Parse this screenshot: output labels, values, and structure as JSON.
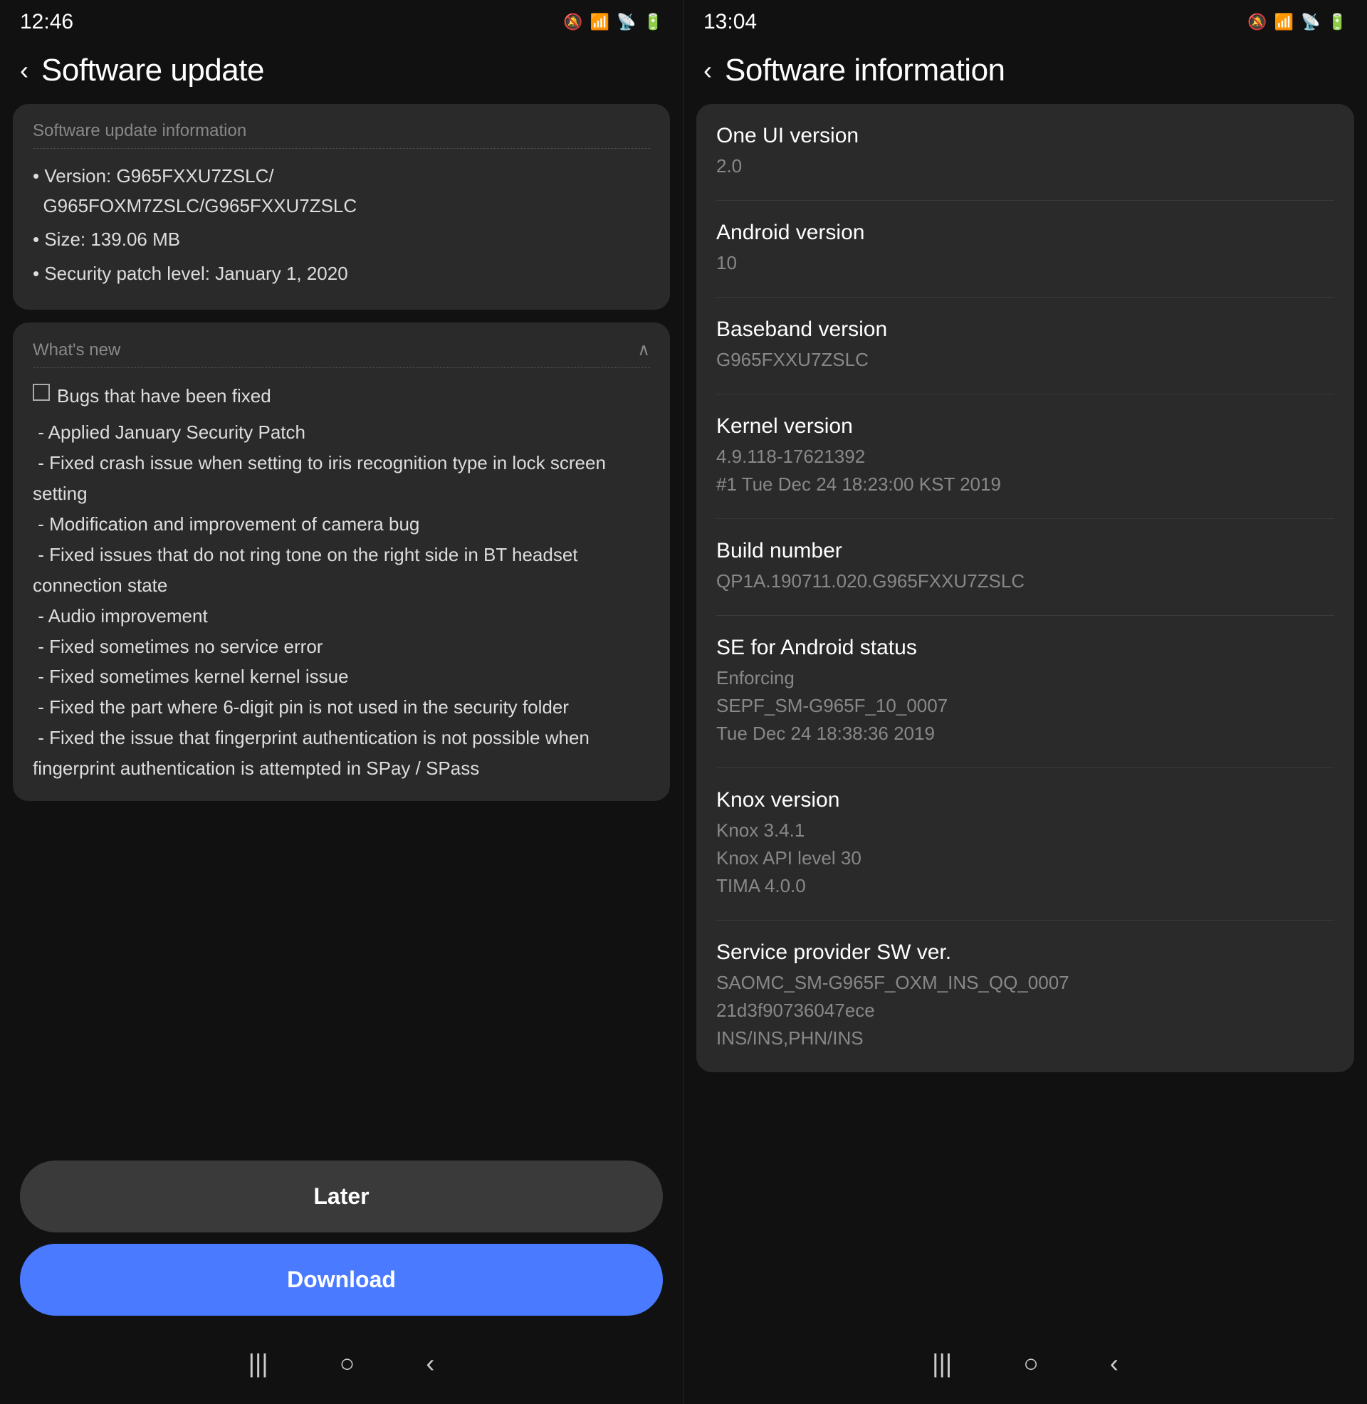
{
  "left": {
    "statusBar": {
      "time": "12:46",
      "icons": "🔕 🌐 📶 🔋"
    },
    "header": {
      "backLabel": "‹",
      "title": "Software update"
    },
    "infoSection": {
      "sectionTitle": "Software update information",
      "items": [
        "• Version: G965FXXU7ZSLC/ G965FOXM7ZSLC/G965FXXU7ZSLC",
        "• Size: 139.06 MB",
        "• Security patch level: January 1, 2020"
      ]
    },
    "whatsNew": {
      "sectionTitle": "What's new",
      "checkboxLabel": "Bugs that have been fixed",
      "bugItems": [
        " - Applied January Security Patch",
        " - Fixed crash issue when setting to iris recognition type in lock screen setting",
        " - Modification and improvement of camera bug",
        " - Fixed issues that do not ring tone on the right side in BT headset connection state",
        " - Audio improvement",
        " - Fixed sometimes no service error",
        " - Fixed sometimes kernel kernel issue",
        " - Fixed the part where 6-digit pin is not used in the security folder",
        " - Fixed the issue that fingerprint authentication is not possible when fingerprint authentication is attempted in SPay / SPass"
      ]
    },
    "buttons": {
      "later": "Later",
      "download": "Download"
    },
    "navBar": {
      "recent": "|||",
      "home": "○",
      "back": "‹"
    }
  },
  "right": {
    "statusBar": {
      "time": "13:04",
      "icons": "🔕 🌐 📶 🔋"
    },
    "header": {
      "backLabel": "‹",
      "title": "Software information"
    },
    "infoRows": [
      {
        "label": "One UI version",
        "value": "2.0"
      },
      {
        "label": "Android version",
        "value": "10"
      },
      {
        "label": "Baseband version",
        "value": "G965FXXU7ZSLC"
      },
      {
        "label": "Kernel version",
        "value": "4.9.118-17621392\n#1 Tue Dec 24 18:23:00 KST 2019"
      },
      {
        "label": "Build number",
        "value": "QP1A.190711.020.G965FXXU7ZSLC"
      },
      {
        "label": "SE for Android status",
        "value": "Enforcing\nSEPF_SM-G965F_10_0007\nTue Dec 24 18:38:36 2019"
      },
      {
        "label": "Knox version",
        "value": "Knox 3.4.1\nKnox API level 30\nTIMA 4.0.0"
      },
      {
        "label": "Service provider SW ver.",
        "value": "SAOMC_SM-G965F_OXM_INS_QQ_0007\n21d3f90736047ece\nINS/INS,PHN/INS"
      }
    ],
    "navBar": {
      "recent": "|||",
      "home": "○",
      "back": "‹"
    }
  }
}
